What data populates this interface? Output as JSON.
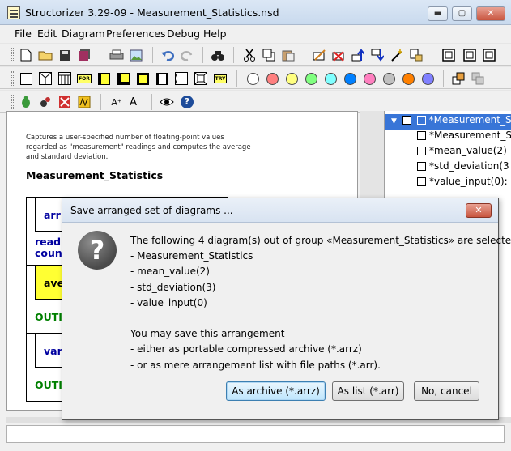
{
  "window": {
    "title": "Structorizer 3.29-09 - Measurement_Statistics.nsd",
    "buttons": {
      "minimize": "▬",
      "maximize": "▢",
      "close": "✕"
    }
  },
  "menu": [
    "File",
    "Edit",
    "Diagram",
    "Preferences",
    "Debug",
    "Help"
  ],
  "toolbar": {
    "row1_icons": [
      "new-file-icon",
      "open-folder-icon",
      "save-icon",
      "save-all-icon",
      "print-icon",
      "export-picture-icon",
      "undo-icon",
      "redo-icon",
      "find-icon",
      "cut-icon",
      "copy-icon",
      "paste-icon",
      "edit-element-icon",
      "delete-element-icon",
      "move-up-icon",
      "move-down-icon",
      "transmute-icon",
      "outsource-icon",
      "nsd-view-icon",
      "frame-view-icon",
      "window-view-icon"
    ],
    "row2_colors": [
      "#ffffff",
      "#ff8080",
      "#ffff80",
      "#80ff80",
      "#80ffff",
      "#0080ff",
      "#ff80c0",
      "#c0c0c0",
      "#ff8000",
      "#8080ff"
    ],
    "row2_labels": {
      "for": "FOR",
      "try": "TRY"
    },
    "row3_labels": {
      "font_up": "A⁺",
      "font_down": "A⁻",
      "about": "?"
    }
  },
  "diagram": {
    "comment": "Captures a user-specified number of floating-point values regarded as \"measurement\" readings and computes the average and standard deviation.",
    "title": "Measurement_Statistics",
    "rows": [
      {
        "text": "arr",
        "kind": "call blue"
      },
      {
        "text": "readi\ncoun",
        "kind": "blue"
      },
      {
        "text": "ave",
        "kind": "call yellow"
      },
      {
        "text": "OUTI",
        "kind": "out"
      },
      {
        "text": "var",
        "kind": "call blue"
      },
      {
        "text": "OUTI",
        "kind": "out"
      }
    ]
  },
  "tree": {
    "items": [
      {
        "label": "*Measurement_S",
        "selected": true
      },
      {
        "label": "*Measurement_S",
        "selected": false
      },
      {
        "label": "*mean_value(2)",
        "selected": false
      },
      {
        "label": "*std_deviation(3",
        "selected": false
      },
      {
        "label": "*value_input(0):",
        "selected": false
      }
    ]
  },
  "dialog": {
    "title": "Save arranged set of diagrams ...",
    "lines": [
      "The following 4 diagram(s) out of group «Measurement_Statistics» are selected:",
      "- Measurement_Statistics",
      "- mean_value(2)",
      "- std_deviation(3)",
      "- value_input(0)",
      "",
      "You may save this arrangement",
      "- either as portable compressed archive (*.arrz)",
      "- or as mere arrangement list with file paths (*.arr)."
    ],
    "buttons": {
      "archive": "As archive (*.arrz)",
      "list": "As list (*.arr)",
      "cancel": "No, cancel"
    },
    "close_glyph": "✕",
    "icon_glyph": "?"
  }
}
